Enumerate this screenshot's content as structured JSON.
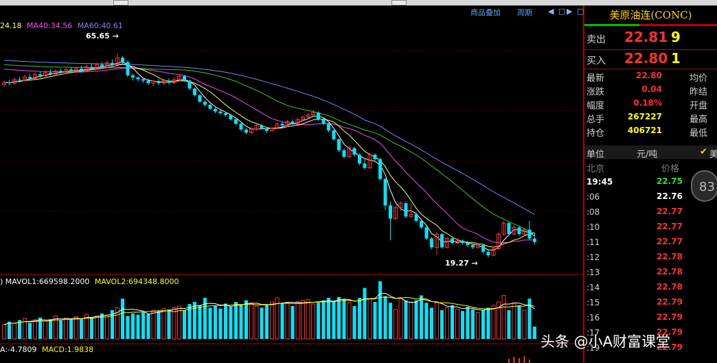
{
  "toolbar": {
    "overlay_label": "商品叠加",
    "period_label": "周期",
    "nav_buttons": [
      "◀",
      "□",
      "▶",
      "□"
    ]
  },
  "ma_legend": [
    {
      "text": "24.18",
      "color": "#ffff66"
    },
    {
      "text": "MA40:34.56",
      "color": "#ff44ff"
    },
    {
      "text": "MA60:40.61",
      "color": "#8080ff"
    }
  ],
  "vol_legend": [
    {
      "text": ") MAVOL1:669598.2000",
      "color": "#ffffff"
    },
    {
      "text": "MAVOL2:694348.8000",
      "color": "#ffff00"
    }
  ],
  "macd_legend": [
    {
      "text": "A:-4.7809",
      "color": "#ffffff"
    },
    {
      "text": "MACD:1.9838",
      "color": "#ffff00"
    }
  ],
  "chart_labels": {
    "high": "65.65",
    "low": "19.27"
  },
  "quote": {
    "title": "美原油连(CONC)",
    "sell": {
      "label": "卖出",
      "price": "22.81",
      "qty": "9"
    },
    "buy": {
      "label": "买入",
      "price": "22.80",
      "qty": "1"
    },
    "details": [
      {
        "label": "最新",
        "value": "22.80",
        "value_color": "#ff3030",
        "right": "均价"
      },
      {
        "label": "涨跌",
        "value": "0.04",
        "value_color": "#ff3030",
        "right": "昨结"
      },
      {
        "label": "幅度",
        "value": "0.18%",
        "value_color": "#ff3030",
        "right": "开盘"
      },
      {
        "label": "总手",
        "value": "267227",
        "value_color": "#ffff00",
        "right": "最高"
      },
      {
        "label": "持仓",
        "value": "406721",
        "value_color": "#ffff00",
        "right": "最低"
      }
    ],
    "unit_label": "单位",
    "unit_value": "元/吨",
    "unit_right": "美",
    "tick_header": {
      "location": "北京",
      "price": "价格"
    },
    "ticks": [
      {
        "time": "19:45",
        "price": "22.75",
        "color": "#30e030"
      },
      {
        "time": ":06",
        "price": "22.76",
        "color": "#ffffff"
      },
      {
        "time": ":08",
        "price": "22.77",
        "color": "#ff3030"
      },
      {
        "time": ":10",
        "price": "22.77",
        "color": "#ff3030"
      },
      {
        "time": ":11",
        "price": "22.77",
        "color": "#ff3030"
      },
      {
        "time": ":12",
        "price": "22.78",
        "color": "#ff3030"
      },
      {
        "time": ":13",
        "price": "22.78",
        "color": "#ff3030"
      },
      {
        "time": ":14",
        "price": "22.78",
        "color": "#ff3030"
      },
      {
        "time": ":15",
        "price": "22.79",
        "color": "#ff3030"
      },
      {
        "time": ":16",
        "price": "22.79",
        "color": "#ff3030"
      },
      {
        "time": ":17",
        "price": "22.79",
        "color": "#ff3030"
      },
      {
        "time": ":19",
        "price": "22.79",
        "color": "#ff3030"
      }
    ]
  },
  "badge": "83",
  "watermark": "头条 @小A财富课堂",
  "colors": {
    "up": "#ff3333",
    "down": "#00e5ff",
    "ma5": "#ffffff",
    "ma10": "#ffff66",
    "ma20": "#ff44ff",
    "ma40": "#33cc33",
    "ma60": "#8080ff",
    "grid": "#7a0000"
  },
  "chart_data": {
    "type": "candlestick",
    "price_range": [
      17,
      73
    ],
    "candles": [
      [
        58.5,
        59.0,
        59.4,
        58.1
      ],
      [
        59.0,
        58.8,
        59.6,
        58.3
      ],
      [
        58.8,
        59.6,
        60.1,
        58.5
      ],
      [
        59.6,
        59.4,
        60.3,
        59.0
      ],
      [
        59.4,
        60.2,
        60.7,
        59.2
      ],
      [
        60.2,
        59.9,
        60.9,
        59.5
      ],
      [
        59.9,
        60.8,
        61.3,
        59.7
      ],
      [
        60.8,
        60.5,
        61.4,
        60.0
      ],
      [
        60.5,
        61.2,
        61.7,
        60.2
      ],
      [
        61.2,
        60.9,
        61.9,
        60.5
      ],
      [
        60.9,
        61.6,
        62.0,
        60.6
      ],
      [
        61.6,
        61.3,
        62.1,
        60.9
      ],
      [
        61.3,
        61.9,
        62.4,
        61.0
      ],
      [
        61.9,
        61.5,
        62.5,
        61.2
      ],
      [
        61.5,
        62.1,
        62.6,
        61.3
      ],
      [
        62.1,
        61.6,
        62.7,
        61.2
      ],
      [
        61.6,
        62.5,
        63.0,
        61.4
      ],
      [
        62.5,
        62.2,
        63.3,
        61.9
      ],
      [
        62.2,
        63.0,
        63.5,
        62.0
      ],
      [
        63.0,
        62.4,
        63.6,
        62.1
      ],
      [
        62.4,
        63.4,
        64.0,
        62.2
      ],
      [
        63.4,
        63.0,
        64.2,
        62.6
      ],
      [
        63.0,
        64.6,
        65.65,
        62.8
      ],
      [
        64.6,
        63.6,
        65.0,
        63.2
      ],
      [
        63.6,
        60.6,
        64.0,
        60.2
      ],
      [
        60.6,
        60.1,
        61.0,
        59.4
      ],
      [
        60.1,
        59.7,
        60.4,
        59.2
      ],
      [
        59.7,
        59.4,
        60.0,
        58.9
      ],
      [
        59.4,
        58.8,
        59.8,
        58.4
      ],
      [
        58.8,
        59.3,
        59.6,
        58.2
      ],
      [
        59.3,
        58.8,
        59.7,
        58.4
      ],
      [
        58.8,
        59.4,
        59.8,
        58.5
      ],
      [
        59.4,
        58.9,
        59.9,
        58.5
      ],
      [
        58.9,
        59.6,
        60.1,
        58.6
      ],
      [
        59.6,
        60.4,
        60.9,
        59.3
      ],
      [
        60.4,
        59.4,
        60.6,
        59.1
      ],
      [
        59.4,
        57.6,
        59.6,
        57.2
      ],
      [
        57.6,
        56.1,
        57.8,
        55.8
      ],
      [
        56.1,
        54.6,
        56.3,
        54.3
      ],
      [
        54.6,
        53.9,
        55.0,
        53.5
      ],
      [
        53.9,
        53.0,
        54.2,
        52.7
      ],
      [
        53.0,
        52.4,
        53.3,
        52.0
      ],
      [
        52.4,
        52.0,
        52.8,
        51.6
      ],
      [
        52.0,
        51.6,
        52.3,
        51.2
      ],
      [
        51.6,
        50.6,
        51.8,
        50.3
      ],
      [
        50.6,
        49.6,
        50.9,
        49.3
      ],
      [
        49.6,
        48.3,
        49.9,
        47.9
      ],
      [
        48.3,
        47.6,
        48.6,
        47.2
      ],
      [
        47.6,
        48.4,
        48.8,
        47.3
      ],
      [
        48.4,
        49.2,
        49.6,
        48.0
      ],
      [
        49.2,
        48.6,
        49.6,
        48.3
      ],
      [
        48.6,
        48.0,
        48.9,
        47.6
      ],
      [
        48.0,
        48.6,
        48.9,
        47.8
      ],
      [
        48.6,
        49.6,
        49.9,
        48.4
      ],
      [
        49.6,
        49.2,
        50.1,
        48.8
      ],
      [
        49.2,
        50.1,
        50.5,
        48.9
      ],
      [
        50.1,
        49.6,
        50.6,
        49.3
      ],
      [
        49.6,
        50.6,
        51.0,
        49.4
      ],
      [
        50.6,
        51.1,
        51.5,
        50.3
      ],
      [
        51.1,
        51.6,
        52.0,
        50.8
      ],
      [
        51.6,
        52.1,
        52.7,
        51.3
      ],
      [
        52.1,
        50.6,
        52.4,
        50.3
      ],
      [
        50.6,
        49.6,
        51.0,
        49.3
      ],
      [
        49.6,
        48.1,
        49.9,
        47.7
      ],
      [
        48.1,
        46.1,
        48.3,
        45.8
      ],
      [
        46.1,
        43.6,
        46.3,
        43.2
      ],
      [
        43.6,
        42.1,
        44.0,
        41.8
      ],
      [
        42.1,
        44.1,
        44.6,
        41.9
      ],
      [
        44.1,
        42.6,
        44.4,
        42.2
      ],
      [
        42.6,
        40.6,
        42.9,
        40.2
      ],
      [
        40.6,
        39.6,
        41.6,
        39.2
      ],
      [
        39.6,
        42.6,
        43.0,
        39.4
      ],
      [
        42.6,
        41.6,
        42.9,
        41.2
      ],
      [
        41.6,
        37.1,
        41.9,
        36.8
      ],
      [
        37.1,
        31.1,
        37.3,
        30.0
      ],
      [
        31.1,
        28.1,
        32.0,
        23.2
      ],
      [
        28.1,
        30.6,
        31.0,
        27.8
      ],
      [
        30.6,
        31.6,
        32.0,
        29.8
      ],
      [
        31.6,
        28.6,
        32.0,
        28.2
      ],
      [
        28.6,
        29.1,
        31.6,
        28.3
      ],
      [
        29.1,
        27.6,
        29.6,
        27.2
      ],
      [
        27.6,
        26.1,
        28.1,
        25.8
      ],
      [
        26.1,
        23.6,
        26.5,
        23.2
      ],
      [
        23.6,
        21.6,
        23.9,
        21.2
      ],
      [
        21.6,
        24.6,
        25.1,
        20.0
      ],
      [
        24.6,
        21.6,
        24.9,
        21.3
      ],
      [
        21.6,
        23.6,
        23.9,
        21.3
      ],
      [
        23.6,
        22.6,
        24.1,
        22.3
      ],
      [
        22.6,
        23.1,
        23.6,
        22.3
      ],
      [
        23.1,
        22.6,
        23.4,
        22.2
      ],
      [
        22.6,
        22.1,
        23.1,
        21.7
      ],
      [
        22.1,
        21.6,
        22.4,
        21.2
      ],
      [
        21.6,
        22.1,
        22.4,
        21.2
      ],
      [
        22.1,
        20.6,
        22.4,
        20.2
      ],
      [
        20.6,
        19.8,
        20.9,
        19.27
      ],
      [
        19.8,
        21.3,
        21.8,
        19.6
      ],
      [
        21.3,
        24.6,
        25.0,
        21.0
      ],
      [
        24.6,
        27.1,
        27.6,
        24.3
      ],
      [
        27.1,
        24.6,
        27.4,
        24.2
      ],
      [
        24.6,
        26.1,
        26.6,
        24.3
      ],
      [
        26.1,
        24.6,
        26.5,
        24.2
      ],
      [
        24.6,
        25.6,
        26.0,
        24.3
      ],
      [
        25.6,
        23.6,
        27.6,
        23.3
      ],
      [
        23.6,
        22.8,
        24.9,
        22.2
      ]
    ],
    "volume_range": [
      0,
      1400000
    ],
    "volumes": [
      350,
      420,
      380,
      460,
      500,
      390,
      470,
      520,
      430,
      480,
      560,
      450,
      510,
      470,
      540,
      490,
      600,
      530,
      560,
      620,
      580,
      700,
      760,
      980,
      560,
      620,
      590,
      650,
      600,
      700,
      690,
      740,
      720,
      760,
      800,
      690,
      850,
      900,
      820,
      1000,
      760,
      800,
      740,
      860,
      780,
      900,
      820,
      940,
      880,
      800,
      760,
      820,
      900,
      1000,
      880,
      860,
      800,
      900,
      940,
      960,
      850,
      880,
      940,
      1000,
      920,
      1020,
      960,
      880,
      800,
      1000,
      1240,
      980,
      900,
      1400,
      1040,
      880,
      720,
      980,
      940,
      900,
      940,
      1060,
      880,
      760,
      880,
      700,
      760,
      820,
      720,
      680,
      780,
      720,
      640,
      700,
      760,
      820,
      900,
      1060,
      700,
      880,
      820,
      700,
      980,
      300
    ]
  }
}
